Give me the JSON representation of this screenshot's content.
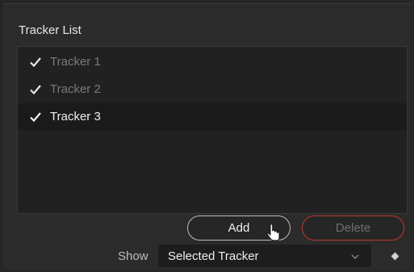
{
  "panel": {
    "title": "Tracker List"
  },
  "tracker_list": {
    "items": [
      {
        "label": "Tracker 1",
        "checked": true,
        "selected": false
      },
      {
        "label": "Tracker 2",
        "checked": true,
        "selected": false
      },
      {
        "label": "Tracker 3",
        "checked": true,
        "selected": true
      }
    ]
  },
  "buttons": {
    "add_label": "Add",
    "delete_label": "Delete"
  },
  "show": {
    "label": "Show",
    "selected": "Selected Tracker"
  },
  "icons": {
    "check": "check-icon",
    "chevron": "chevron-down-icon",
    "keyframe": "diamond-icon",
    "cursor": "pointer-cursor-icon"
  },
  "colors": {
    "background": "#2b2b2b",
    "list_background": "#212121",
    "selected_row": "#1a1a1a",
    "delete_border": "#c0392b"
  }
}
